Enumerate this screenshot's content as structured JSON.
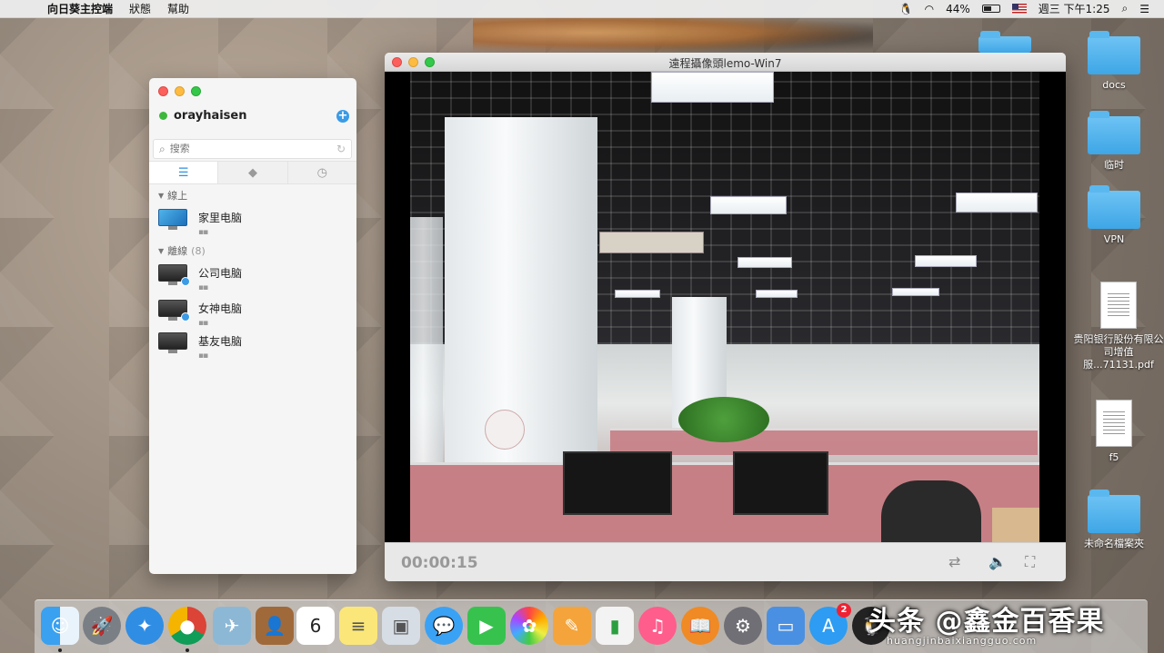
{
  "menubar": {
    "app_name": "向日葵主控端",
    "menus": [
      "狀態",
      "幫助"
    ],
    "battery": "44%",
    "clock": "週三 下午1:25"
  },
  "oray": {
    "username": "orayhaisen",
    "search_placeholder": "搜索",
    "sections": {
      "online": {
        "label": "線上"
      },
      "offline": {
        "label": "離線",
        "count": "(8)"
      }
    },
    "devices": [
      {
        "name": "家里电脑"
      },
      {
        "name": "公司电脑"
      },
      {
        "name": "女神电脑"
      },
      {
        "name": "基友电脑"
      }
    ]
  },
  "camera": {
    "title": "遠程攝像頭lemo-Win7",
    "time": "00:00:15"
  },
  "desktop_icons": [
    {
      "label": ""
    },
    {
      "label": "docs"
    },
    {
      "label": "临时"
    },
    {
      "label": "VPN"
    },
    {
      "label": "贵阳银行股份有限公司增值服...71131.pdf"
    },
    {
      "label": "f5"
    },
    {
      "label": "未命名檔案夾"
    }
  ],
  "dock": {
    "calendar_day": "6",
    "appstore_badge": "2"
  },
  "watermark": {
    "text": "头条 @鑫金百香果",
    "url": "huangjinbaixiangguo.com"
  }
}
